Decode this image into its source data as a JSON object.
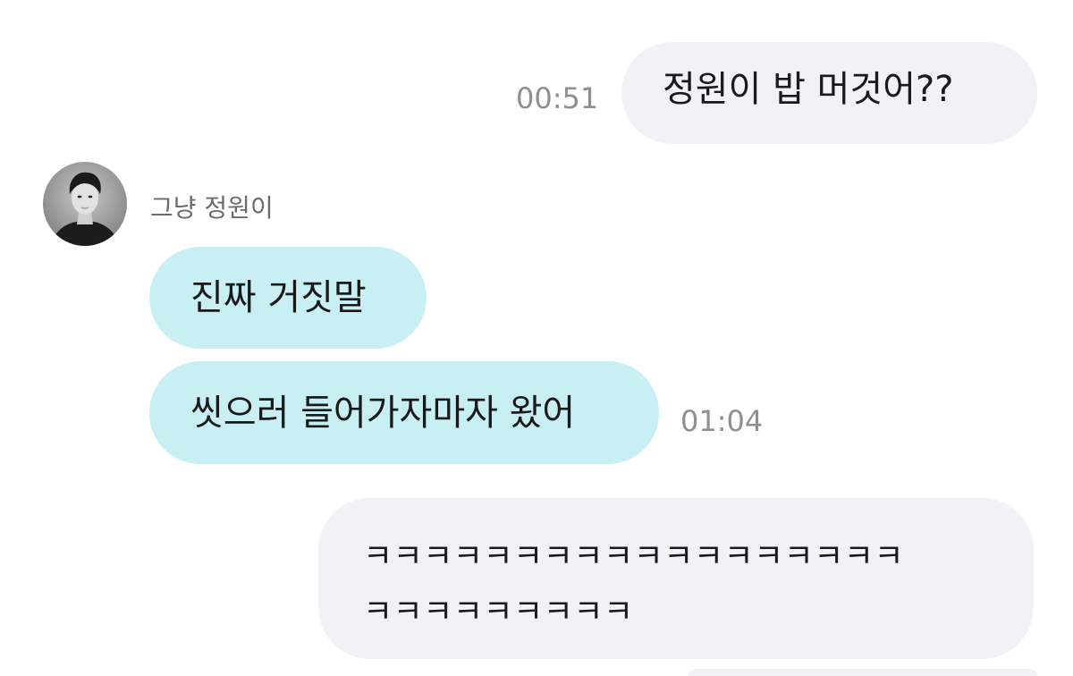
{
  "messages": [
    {
      "direction": "out",
      "text": "정원이 밥 머것어??",
      "time": "00:51"
    },
    {
      "direction": "in",
      "sender": "그냥 정원이",
      "text": "진짜 거짓말"
    },
    {
      "direction": "in",
      "text": "씻으러 들어가자마자 왔어",
      "time": "01:04"
    },
    {
      "direction": "out",
      "lines": [
        "ㅋㅋㅋㅋㅋㅋㅋㅋㅋㅋㅋㅋㅋㅋㅋㅋㅋㅋ",
        "ㅋㅋㅋㅋㅋㅋㅋㅋㅋ"
      ]
    }
  ],
  "avatar_icon": "profile-photo",
  "colors": {
    "outgoing_bubble": "#f1f1f6",
    "incoming_bubble": "#c8eff3",
    "timestamp": "#8e8e93",
    "sender_name": "#6b6b6b"
  }
}
